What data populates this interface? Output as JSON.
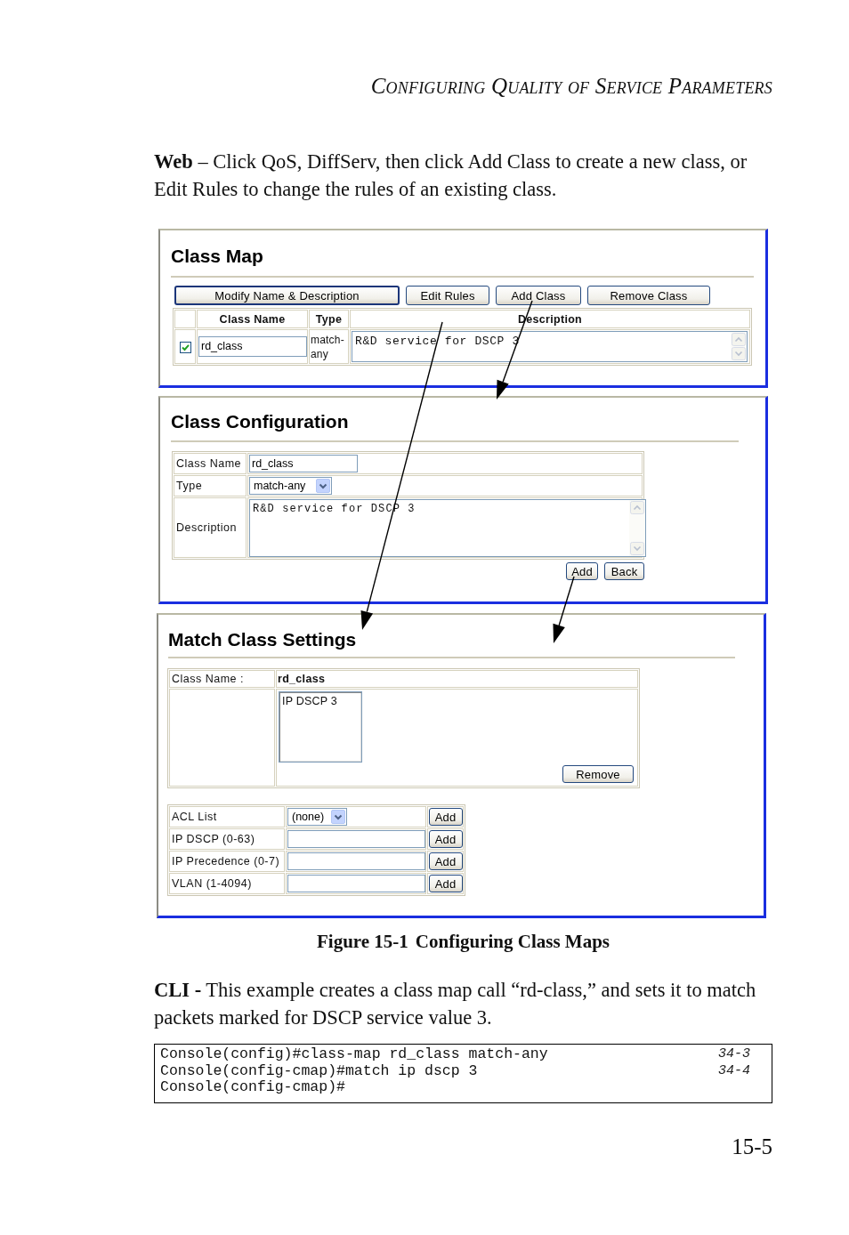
{
  "header": {
    "running_title": "Configuring Quality of Service Parameters"
  },
  "intro": "**Web** – Click QoS, DiffServ, then click Add Class to create a new class, or Edit Rules to change the rules of an existing class.",
  "figure": {
    "class_map": {
      "title": "Class Map",
      "buttons": [
        {
          "label": "Modify Name & Description",
          "focused": true
        },
        {
          "label": "Edit Rules",
          "focused": false
        },
        {
          "label": "Add Class",
          "focused": false
        },
        {
          "label": "Remove Class",
          "focused": false
        }
      ],
      "columns": [
        "Class Name",
        "Type",
        "Description"
      ],
      "rows": [
        {
          "checked": true,
          "class_name": "rd_class",
          "type": "match-any",
          "description": "R&D service for DSCP 3"
        }
      ]
    },
    "class_configuration": {
      "title": "Class Configuration",
      "fields": [
        {
          "kind": "text",
          "label": "Class Name",
          "value": "rd_class"
        },
        {
          "kind": "select",
          "label": "Type",
          "value": "match-any"
        },
        {
          "kind": "textarea",
          "label": "Description",
          "value": "R&D service for DSCP 3"
        }
      ],
      "buttons": [
        "Add",
        "Back"
      ]
    },
    "match_class_settings": {
      "title": "Match Class Settings",
      "class_name_label": "Class Name :",
      "class_name": "rd_class",
      "rules": [
        {
          "label": "IP DSCP 3",
          "selected": false
        }
      ],
      "remove_button": "Remove",
      "criteria": [
        {
          "kind": "select",
          "label": "ACL List",
          "value": "(none)",
          "button": "Add"
        },
        {
          "kind": "text",
          "label": "IP DSCP (0-63)",
          "button": "Add"
        },
        {
          "kind": "text",
          "label": "IP Precedence (0-7)",
          "button": "Add"
        },
        {
          "kind": "text",
          "label": "VLAN (1-4094)",
          "button": "Add"
        }
      ]
    }
  },
  "caption": {
    "label": "Figure 15-1",
    "title": "Configuring Class Maps"
  },
  "cli": {
    "text": "**CLI -** This example creates a class map call “rd-class,” and sets it to match packets marked for DSCP service value 3.",
    "lines": [
      {
        "command": "Console(config)#class-map rd_class match-any",
        "ref": "34-3"
      },
      {
        "command": "Console(config-cmap)#match ip dscp 3",
        "ref": "34-4"
      },
      {
        "command": "Console(config-cmap)#"
      }
    ]
  },
  "page_number": "15-5"
}
